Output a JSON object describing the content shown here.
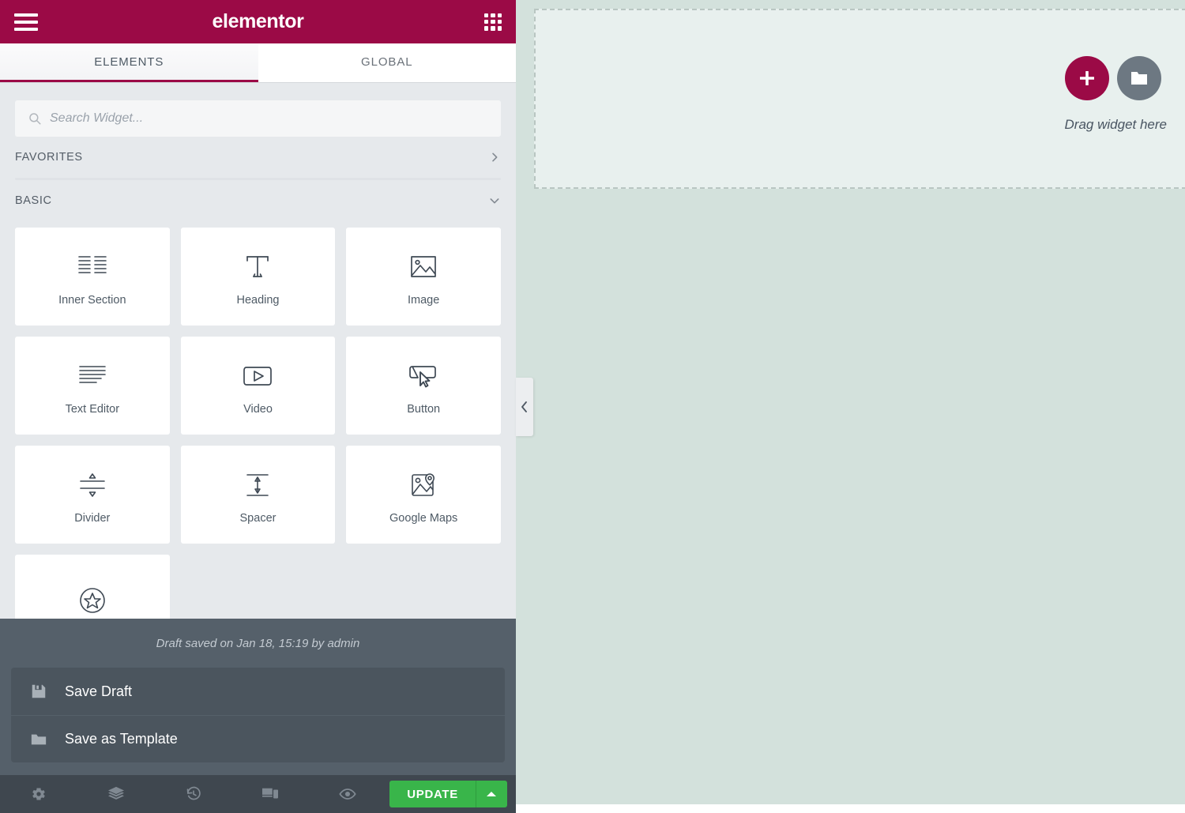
{
  "header": {
    "brand": "elementor",
    "menu_icon": "hamburger-icon",
    "apps_icon": "grid-apps-icon"
  },
  "tabs": [
    {
      "label": "ELEMENTS",
      "active": true
    },
    {
      "label": "GLOBAL",
      "active": false
    }
  ],
  "search": {
    "placeholder": "Search Widget...",
    "value": "",
    "icon": "search-icon"
  },
  "categories": [
    {
      "label": "FAVORITES",
      "expanded": false,
      "chevron": "chevron-right-icon"
    },
    {
      "label": "BASIC",
      "expanded": true,
      "chevron": "chevron-down-icon"
    }
  ],
  "widgets": [
    {
      "label": "Inner Section",
      "icon": "inner-section-icon"
    },
    {
      "label": "Heading",
      "icon": "heading-t-icon"
    },
    {
      "label": "Image",
      "icon": "image-icon"
    },
    {
      "label": "Text Editor",
      "icon": "text-lines-icon"
    },
    {
      "label": "Video",
      "icon": "video-play-icon"
    },
    {
      "label": "Button",
      "icon": "button-cursor-icon"
    },
    {
      "label": "Divider",
      "icon": "divider-icon"
    },
    {
      "label": "Spacer",
      "icon": "spacer-arrows-icon"
    },
    {
      "label": "Google Maps",
      "icon": "google-maps-icon"
    },
    {
      "label": "",
      "icon": "star-circle-icon"
    }
  ],
  "save_menu": {
    "draft_status": "Draft saved on Jan 18, 15:19 by admin",
    "items": [
      {
        "label": "Save Draft",
        "icon": "floppy-disk-icon"
      },
      {
        "label": "Save as Template",
        "icon": "folder-icon"
      }
    ]
  },
  "toolbar": {
    "tools": [
      {
        "name": "settings",
        "icon": "gear-icon"
      },
      {
        "name": "navigator",
        "icon": "layers-icon"
      },
      {
        "name": "history",
        "icon": "history-clock-icon"
      },
      {
        "name": "responsive",
        "icon": "devices-icon"
      },
      {
        "name": "preview",
        "icon": "eye-icon"
      }
    ],
    "update_label": "UPDATE",
    "update_caret_icon": "caret-up-icon"
  },
  "canvas": {
    "collapse_icon": "chevron-left-icon",
    "dropzone": {
      "caption": "Drag widget here",
      "add_icon": "plus-icon",
      "template_icon": "folder-icon"
    }
  },
  "colors": {
    "brand": "#9b0a46",
    "panel_bg": "#e6e9ec",
    "canvas_bg": "#d3e1dc",
    "dropzone_bg": "#e8f0ee",
    "toolbar_bg": "#3f474f",
    "save_menu_bg": "#55606a",
    "update_green": "#39b54a"
  }
}
